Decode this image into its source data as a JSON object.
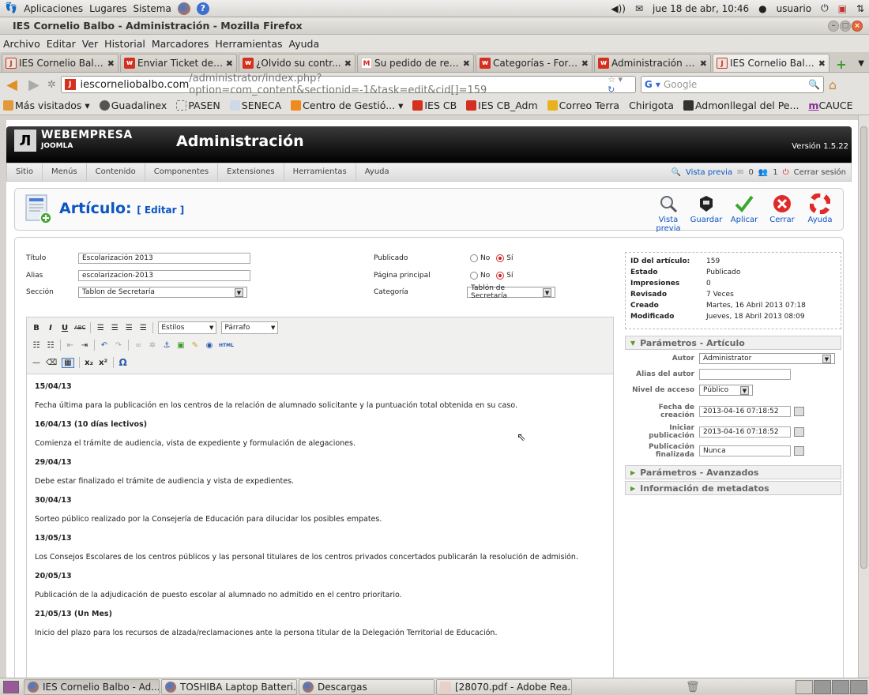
{
  "gnome_panel": {
    "menus": [
      "Aplicaciones",
      "Lugares",
      "Sistema"
    ],
    "datetime": "jue 18 de abr, 10:46",
    "user": "usuario"
  },
  "window": {
    "title": "IES Cornelio Balbo - Administración - Mozilla Firefox"
  },
  "menubar": [
    "Archivo",
    "Editar",
    "Ver",
    "Historial",
    "Marcadores",
    "Herramientas",
    "Ayuda"
  ],
  "tabs": [
    {
      "label": "IES Cornelio Balb...",
      "icon": "j"
    },
    {
      "label": "Enviar Ticket de ...",
      "icon": "w"
    },
    {
      "label": "¿Olvido su contr...",
      "icon": "w"
    },
    {
      "label": "Su pedido de ren...",
      "icon": "m"
    },
    {
      "label": "Categorías - Foro...",
      "icon": "w"
    },
    {
      "label": "Administración - ...",
      "icon": "w"
    },
    {
      "label": "IES Cornelio Balb...",
      "icon": "j",
      "active": true
    }
  ],
  "navbar": {
    "url_domain": "iescorneliobalbo.com",
    "url_path": "/administrator/index.php?option=com_content&sectionid=-1&task=edit&cid[]=159",
    "search_placeholder": "Google"
  },
  "bookmarks": [
    "Más visitados ▾",
    "Guadalinex",
    "PASEN",
    "SENECA",
    "Centro de Gestió... ▾",
    "IES CB",
    "IES CB_Adm",
    "Correo Terra",
    "Chirigota",
    "Admonllegal del Pe...",
    "CAUCE"
  ],
  "joomla": {
    "brand": "WEBEMPRESA",
    "brand_sub": "JOOMLA",
    "title": "Administración",
    "version": "Versión 1.5.22",
    "menu": [
      "Sitio",
      "Menús",
      "Contenido",
      "Componentes",
      "Extensiones",
      "Herramientas",
      "Ayuda"
    ],
    "status": {
      "preview": "Vista previa",
      "messages": "0",
      "users": "1",
      "logout": "Cerrar sesión"
    }
  },
  "article_header": {
    "title": "Artículo:",
    "subtitle": "[ Editar ]",
    "tools": [
      "Vista previa",
      "Guardar",
      "Aplicar",
      "Cerrar",
      "Ayuda"
    ]
  },
  "form": {
    "title_label": "Título",
    "title_value": "Escolarización 2013",
    "alias_label": "Alias",
    "alias_value": "escolarizacion-2013",
    "section_label": "Sección",
    "section_value": "Tablon de Secretaría",
    "published_label": "Publicado",
    "frontpage_label": "Página principal",
    "category_label": "Categoría",
    "category_value": "Tablón de Secretaría",
    "no_label": "No",
    "yes_label": "Sí"
  },
  "editor": {
    "styles": "Estilos",
    "format": "Párrafo",
    "content": [
      {
        "text": "15/04/13",
        "bold": true
      },
      {
        "text": "Fecha última para la publicación en los centros de la relación de alumnado solicitante y la puntuación total obtenida en su caso.",
        "bold": false
      },
      {
        "text": "16/04/13  (10 días lectivos)",
        "bold": true
      },
      {
        "text": "Comienza el trámite de audiencia, vista de expediente y formulación de alegaciones.",
        "bold": false
      },
      {
        "text": "29/04/13",
        "bold": true
      },
      {
        "text": "Debe estar finalizado el trámite de audiencia y vista de expedientes.",
        "bold": false
      },
      {
        "text": "30/04/13",
        "bold": true
      },
      {
        "text": "Sorteo público realizado por la Consejería de Educación para dilucidar los posibles empates.",
        "bold": false
      },
      {
        "text": "13/05/13",
        "bold": true
      },
      {
        "text": "Los Consejos Escolares de los centros públicos y las personal titulares de los centros privados concertados publicarán la resolución de admisión.",
        "bold": false
      },
      {
        "text": "20/05/13",
        "bold": true
      },
      {
        "text": "Publicación de la adjudicación de puesto escolar al alumnado no admitido en el centro prioritario.",
        "bold": false
      },
      {
        "text": "21/05/13 (Un Mes)",
        "bold": true
      },
      {
        "text": "Inicio del plazo para los recursos de alzada/reclamaciones ante la persona titular de la Delegación Territorial de Educación.",
        "bold": false
      }
    ]
  },
  "info": [
    {
      "k": "ID del artículo:",
      "v": "159"
    },
    {
      "k": "Estado",
      "v": "Publicado"
    },
    {
      "k": "Impresiones",
      "v": "0"
    },
    {
      "k": "Revisado",
      "v": "7 Veces"
    },
    {
      "k": "Creado",
      "v": "Martes, 16 Abril 2013 07:18"
    },
    {
      "k": "Modificado",
      "v": "Jueves, 18 Abril 2013 08:09"
    }
  ],
  "params": {
    "head": "Parámetros - Artículo",
    "author_label": "Autor",
    "author_value": "Administrator",
    "alias_label": "Alias del autor",
    "alias_value": "",
    "access_label": "Nivel de acceso",
    "access_value": "Público",
    "created_label": "Fecha de creación",
    "created_value": "2013-04-16 07:18:52",
    "start_label": "Iniciar publicación",
    "start_value": "2013-04-16 07:18:52",
    "end_label_1": "Publicación",
    "end_label_2": "finalizada",
    "end_value": "Nunca",
    "advanced_head": "Parámetros - Avanzados",
    "meta_head": "Información de metadatos"
  },
  "taskbar": [
    {
      "label": "IES Cornelio Balbo - Ad...",
      "active": true
    },
    {
      "label": "TOSHIBA Laptop Batteri..."
    },
    {
      "label": "Descargas"
    },
    {
      "label": "[28070.pdf - Adobe Rea..."
    }
  ],
  "colors": {
    "joomla_blue": "#0b55c4",
    "firefox_orange": "#e0902a"
  }
}
